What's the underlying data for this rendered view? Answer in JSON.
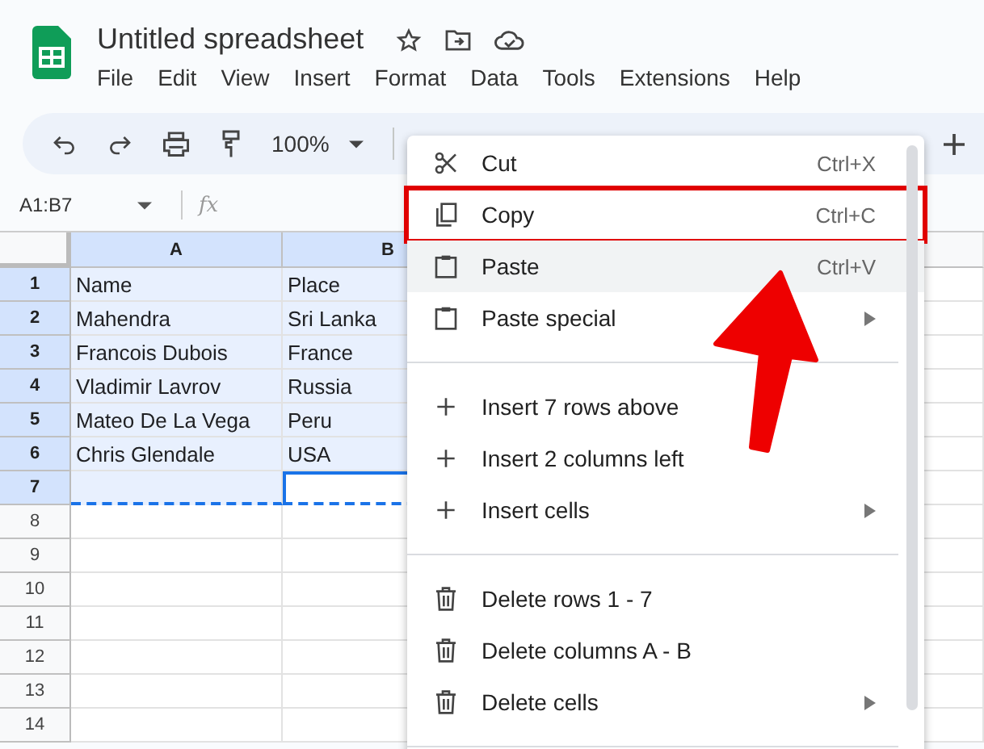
{
  "document": {
    "title": "Untitled spreadsheet"
  },
  "menubar": [
    "File",
    "Edit",
    "View",
    "Insert",
    "Format",
    "Data",
    "Tools",
    "Extensions",
    "Help"
  ],
  "toolbar": {
    "zoom": "100%"
  },
  "formula_bar": {
    "name_box": "A1:B7",
    "label": "fx"
  },
  "grid": {
    "columns": [
      {
        "label": "A",
        "selected": true
      },
      {
        "label": "B",
        "selected": true
      }
    ],
    "rows": [
      {
        "number": "1",
        "selected": true,
        "cells": [
          {
            "text": "Name",
            "active": false
          },
          {
            "text": "Place",
            "active": false
          }
        ]
      },
      {
        "number": "2",
        "selected": true,
        "cells": [
          {
            "text": "Mahendra",
            "active": false
          },
          {
            "text": "Sri Lanka",
            "active": false
          }
        ]
      },
      {
        "number": "3",
        "selected": true,
        "cells": [
          {
            "text": "Francois Dubois",
            "active": false
          },
          {
            "text": "France",
            "active": false
          }
        ]
      },
      {
        "number": "4",
        "selected": true,
        "cells": [
          {
            "text": "Vladimir Lavrov",
            "active": false
          },
          {
            "text": "Russia",
            "active": false
          }
        ]
      },
      {
        "number": "5",
        "selected": true,
        "cells": [
          {
            "text": "Mateo De La Vega",
            "active": false
          },
          {
            "text": "Peru",
            "active": false
          }
        ]
      },
      {
        "number": "6",
        "selected": true,
        "cells": [
          {
            "text": "Chris Glendale",
            "active": false
          },
          {
            "text": "USA",
            "active": false
          }
        ]
      },
      {
        "number": "7",
        "selected": true,
        "cells": [
          {
            "active": false
          },
          {
            "active": true
          }
        ]
      },
      {
        "number": "8",
        "selected": false,
        "cells": []
      },
      {
        "number": "9",
        "selected": false,
        "cells": []
      },
      {
        "number": "10",
        "selected": false,
        "cells": []
      },
      {
        "number": "11",
        "selected": false,
        "cells": []
      },
      {
        "number": "12",
        "selected": false,
        "cells": []
      },
      {
        "number": "13",
        "selected": false,
        "cells": []
      },
      {
        "number": "14",
        "selected": false,
        "cells": []
      }
    ]
  },
  "context_menu": [
    {
      "kind": "cut",
      "label": "Cut",
      "shortcut": "Ctrl+X",
      "hovered": false,
      "submenu": false,
      "annotated": false
    },
    {
      "kind": "copy",
      "label": "Copy",
      "shortcut": "Ctrl+C",
      "hovered": false,
      "submenu": false,
      "annotated": true
    },
    {
      "kind": "paste",
      "label": "Paste",
      "shortcut": "Ctrl+V",
      "hovered": true,
      "submenu": false,
      "annotated": false
    },
    {
      "kind": "paste",
      "label": "Paste special",
      "hovered": false,
      "submenu": true,
      "annotated": false
    },
    {
      "kind": "divider"
    },
    {
      "kind": "insert",
      "label": "Insert 7 rows above",
      "hovered": false,
      "submenu": false,
      "annotated": false
    },
    {
      "kind": "insert",
      "label": "Insert 2 columns left",
      "hovered": false,
      "submenu": false,
      "annotated": false
    },
    {
      "kind": "insert",
      "label": "Insert cells",
      "hovered": false,
      "submenu": true,
      "annotated": false
    },
    {
      "kind": "divider"
    },
    {
      "kind": "delete",
      "label": "Delete rows 1 - 7",
      "hovered": false,
      "submenu": false,
      "annotated": false
    },
    {
      "kind": "delete",
      "label": "Delete columns A - B",
      "hovered": false,
      "submenu": false,
      "annotated": false
    },
    {
      "kind": "delete",
      "label": "Delete cells",
      "hovered": false,
      "submenu": true,
      "annotated": false
    },
    {
      "kind": "divider"
    }
  ]
}
